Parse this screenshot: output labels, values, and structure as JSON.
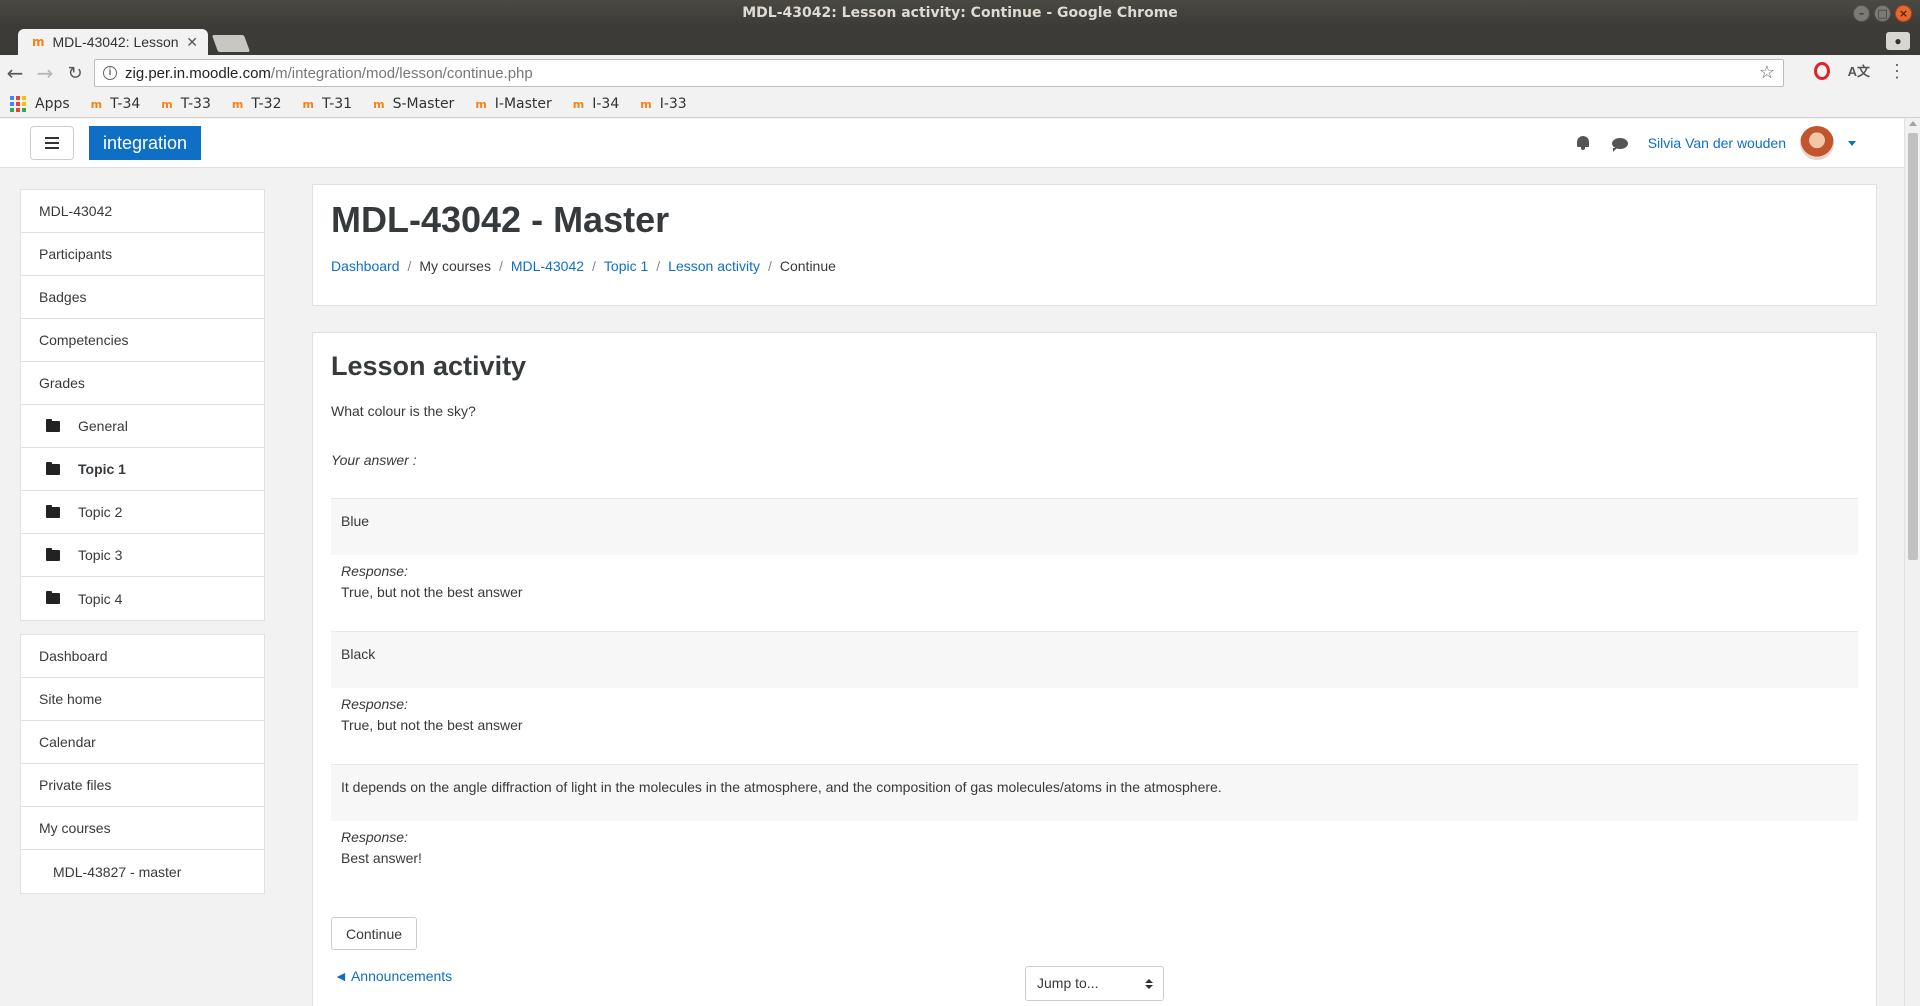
{
  "window": {
    "title": "MDL-43042: Lesson activity: Continue - Google Chrome",
    "tab_title": "MDL-43042: Lesson",
    "url_host": "zig.per.in.moodle.com",
    "url_path": "/m/integration/mod/lesson/continue.php"
  },
  "bookmarks": {
    "apps_label": "Apps",
    "items": [
      "T-34",
      "T-33",
      "T-32",
      "T-31",
      "S-Master",
      "I-Master",
      "I-34",
      "I-33"
    ]
  },
  "navbar": {
    "brand": "integration",
    "user_name": "Silvia Van der wouden"
  },
  "sidebar": {
    "course_nav": [
      {
        "label": "MDL-43042"
      },
      {
        "label": "Participants"
      },
      {
        "label": "Badges"
      },
      {
        "label": "Competencies"
      },
      {
        "label": "Grades"
      },
      {
        "label": "General"
      },
      {
        "label": "Topic 1"
      },
      {
        "label": "Topic 2"
      },
      {
        "label": "Topic 3"
      },
      {
        "label": "Topic 4"
      }
    ],
    "site_nav": [
      {
        "label": "Dashboard"
      },
      {
        "label": "Site home"
      },
      {
        "label": "Calendar"
      },
      {
        "label": "Private files"
      },
      {
        "label": "My courses"
      },
      {
        "label": "MDL-43827 - master"
      }
    ]
  },
  "header": {
    "title": "MDL-43042 - Master",
    "breadcrumb": [
      "Dashboard",
      "My courses",
      "MDL-43042",
      "Topic 1",
      "Lesson activity",
      "Continue"
    ]
  },
  "main": {
    "heading": "Lesson activity",
    "question": "What colour is the sky?",
    "your_answer_label": "Your answer :",
    "response_label": "Response:",
    "answers": [
      {
        "answer": "Blue",
        "response": "True, but not the best answer"
      },
      {
        "answer": "Black",
        "response": "True, but not the best answer"
      },
      {
        "answer": "It depends on the angle diffraction of light in the molecules in the atmosphere, and the composition of gas molecules/atoms in the atmosphere.",
        "response": "Best answer!"
      }
    ],
    "continue_label": "Continue",
    "prev_link": "◄ Announcements",
    "jump_select": "Jump to..."
  }
}
